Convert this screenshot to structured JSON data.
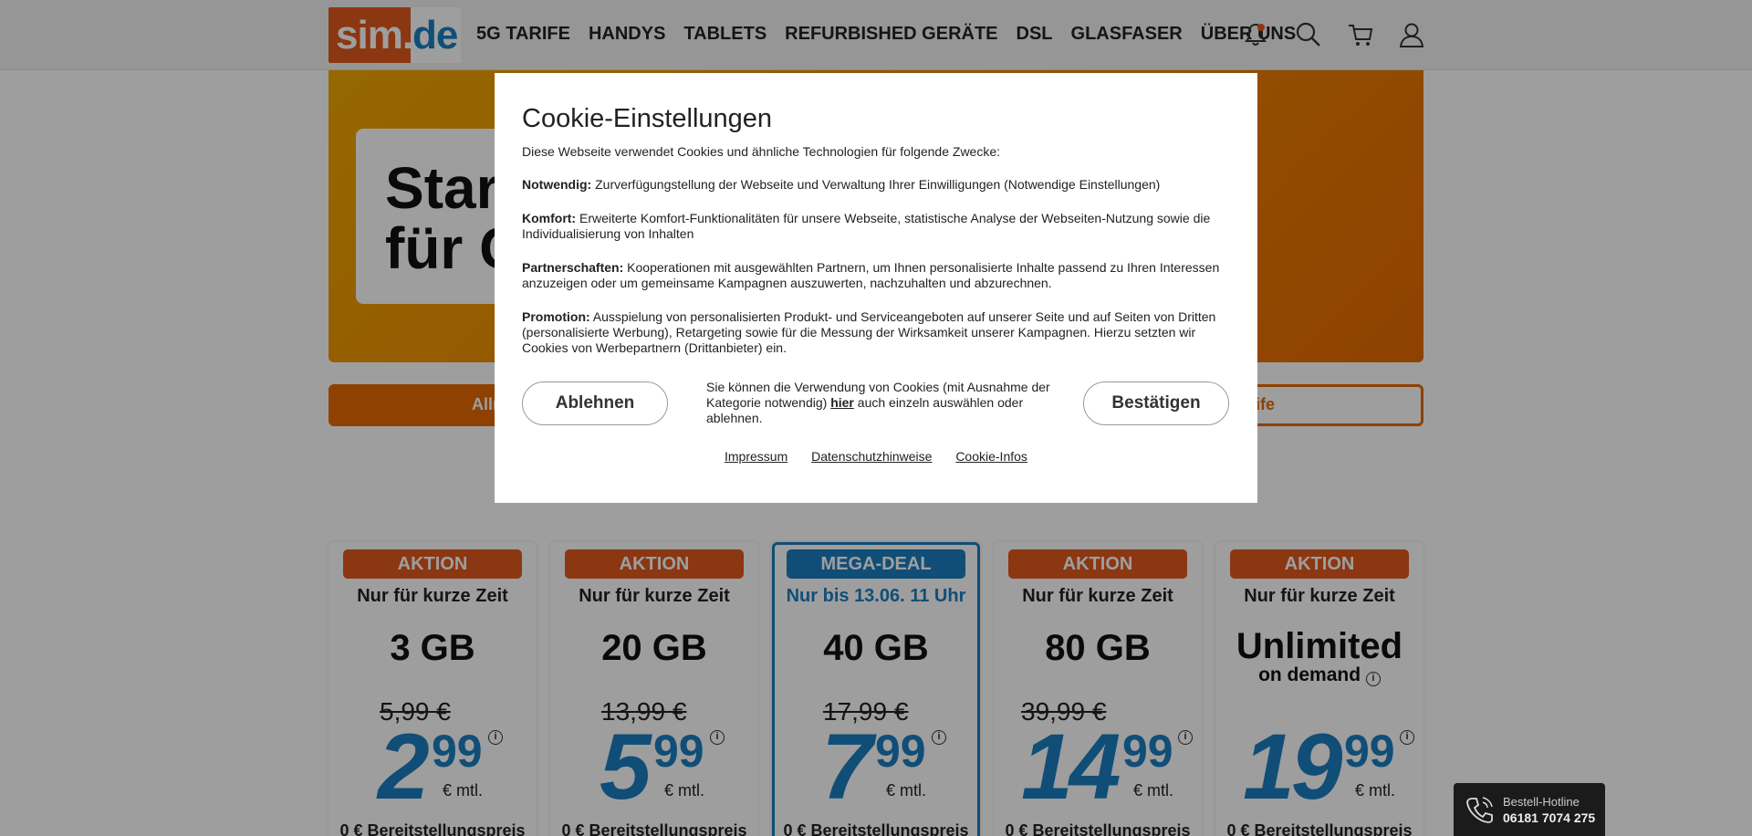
{
  "logo": {
    "part1": "sim.",
    "part2": "de"
  },
  "nav": {
    "items": [
      "5G TARIFE",
      "HANDYS",
      "TABLETS",
      "REFURBISHED GERÄTE",
      "DSL",
      "GLASFASER",
      "ÜBER UNS"
    ]
  },
  "header_icons": [
    "bell-icon",
    "search-icon",
    "cart-icon",
    "user-icon"
  ],
  "hero": {
    "title": "Stark\nfür G"
  },
  "filter": {
    "left_label": "Allr",
    "right_label": "arife"
  },
  "cards": [
    {
      "badge": "AKTION",
      "subline": "Nur für kurze Zeit",
      "volume": "3 GB",
      "old_price": "5,99 €",
      "price_int": "2",
      "price_cents": "99",
      "per_month": "€ mtl.",
      "setup": "0 € Bereitstellungspreis"
    },
    {
      "badge": "AKTION",
      "subline": "Nur für kurze Zeit",
      "volume": "20 GB",
      "old_price": "13,99 €",
      "price_int": "5",
      "price_cents": "99",
      "per_month": "€ mtl.",
      "setup": "0 € Bereitstellungspreis"
    },
    {
      "badge": "MEGA-DEAL",
      "subline": "Nur bis 13.06. 11 Uhr",
      "volume": "40 GB",
      "old_price": "17,99 €",
      "price_int": "7",
      "price_cents": "99",
      "per_month": "€ mtl.",
      "setup": "0 € Bereitstellungspreis"
    },
    {
      "badge": "AKTION",
      "subline": "Nur für kurze Zeit",
      "volume": "80 GB",
      "old_price": "39,99 €",
      "price_int": "14",
      "price_cents": "99",
      "per_month": "€ mtl.",
      "setup": "0 € Bereitstellungspreis"
    },
    {
      "badge": "AKTION",
      "subline": "Nur für kurze Zeit",
      "volume": "Unlimited",
      "volume_note": "on demand",
      "old_price": "",
      "price_int": "19",
      "price_cents": "99",
      "per_month": "€ mtl.",
      "setup": "0 € Bereitstellungspreis"
    }
  ],
  "cookie_dialog": {
    "title": "Cookie-Einstellungen",
    "intro": "Diese Webseite verwendet Cookies und ähnliche Technologien für folgende Zwecke:",
    "sections": [
      {
        "label": "Notwendig:",
        "text": "Zurverfügungstellung der Webseite und Verwaltung Ihrer Einwilligungen (Notwendige Einstellungen)"
      },
      {
        "label": "Komfort:",
        "text": "Erweiterte Komfort-Funktionalitäten für unsere Webseite, statistische Analyse der Webseiten-Nutzung sowie die Individualisierung von Inhalten"
      },
      {
        "label": "Partnerschaften:",
        "text": "Kooperationen mit ausgewählten Partnern, um Ihnen personalisierte Inhalte passend zu Ihren Interessen anzuzeigen oder um gemeinsame Kampagnen auszuwerten, nachzuhalten und abzurechnen."
      },
      {
        "label": "Promotion:",
        "text": "Ausspielung von personalisierten Produkt- und Serviceangeboten auf unserer Seite und auf Seiten von Dritten (personalisierte Werbung), Retargeting sowie für die Messung der Wirksamkeit unserer Kampagnen. Hierzu setzten wir Cookies von Werbepartnern (Drittanbieter) ein."
      }
    ],
    "reject_label": "Ablehnen",
    "confirm_label": "Bestätigen",
    "middle_text_before": "Sie können die Verwendung von Cookies (mit Ausnahme der Kategorie notwendig) ",
    "middle_link": "hier",
    "middle_text_after": " auch einzeln auswählen oder ablehnen.",
    "footer_links": [
      "Impressum",
      "Datenschutzhinweise",
      "Cookie-Infos"
    ]
  },
  "hotline": {
    "label": "Bestell-Hotline",
    "number": "06181 7074 275"
  },
  "colors": {
    "brand_orange": "#e05a1e",
    "brand_blue": "#1a7fc1"
  }
}
